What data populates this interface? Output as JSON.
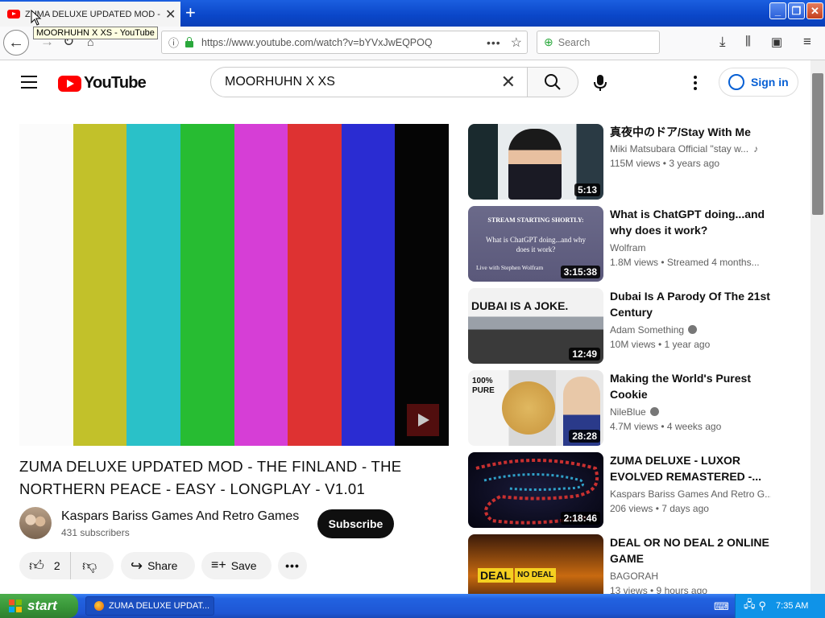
{
  "browser": {
    "tab_title": "ZUMA DELUXE UPDATED MOD - THE FINLAND",
    "tooltip": "MOORHUHN X XS - YouTube",
    "url": "https://www.youtube.com/watch?v=bYVxJwEQPOQ",
    "search_placeholder": "Search"
  },
  "yt_header": {
    "logo_text": "YouTube",
    "search_query": "MOORHUHN X XS",
    "signin_label": "Sign in"
  },
  "player": {
    "colors": [
      "#fbfbfb",
      "#c2c12a",
      "#2ac1c8",
      "#27bc32",
      "#d63ed6",
      "#de3232",
      "#2a2cd2",
      "#050505"
    ]
  },
  "video": {
    "title": "ZUMA DELUXE UPDATED MOD - THE FINLAND - THE NORTHERN PEACE - EASY - LONGPLAY - V1.01",
    "channel": "Kaspars Bariss Games And Retro Games",
    "subscribers": "431 subscribers",
    "subscribe_label": "Subscribe",
    "likes": "2",
    "share_label": "Share",
    "save_label": "Save"
  },
  "recommendations": [
    {
      "title": "真夜中のドア/Stay With Me",
      "channel": "Miki Matsubara Official \"stay w...",
      "meta": "115M views  •  3 years ago",
      "duration": "5:13",
      "verified": false
    },
    {
      "title": "What is ChatGPT doing...and why does it work?",
      "channel": "Wolfram",
      "meta": "1.8M views  •  Streamed 4 months...",
      "duration": "3:15:38",
      "verified": false,
      "thumb_text": "STREAM STARTING SHORTLY:",
      "thumb_text2": "What is ChatGPT doing...and why does it work?",
      "thumb_text3": "Live with Stephen Wolfram"
    },
    {
      "title": "Dubai Is A Parody Of The 21st Century",
      "channel": "Adam Something",
      "meta": "10M views  •  1 year ago",
      "duration": "12:49",
      "verified": true,
      "thumb_text": "DUBAI IS A JOKE."
    },
    {
      "title": "Making the World's Purest Cookie",
      "channel": "NileBlue",
      "meta": "4.7M views  •  4 weeks ago",
      "duration": "28:28",
      "verified": true,
      "thumb_text": "100% PURE"
    },
    {
      "title": "ZUMA DELUXE - LUXOR EVOLVED REMASTERED -...",
      "channel": "Kaspars Bariss Games And Retro G...",
      "meta": "206 views  •  7 days ago",
      "duration": "2:18:46",
      "verified": false
    },
    {
      "title": "DEAL OR NO DEAL 2 ONLINE GAME",
      "channel": "BAGORAH",
      "meta": "13 views  •  9 hours ago",
      "duration": "",
      "verified": false,
      "thumb_text": "DEAL",
      "thumb_text2": "NO DEAL"
    }
  ],
  "taskbar": {
    "start_label": "start",
    "task_label": "ZUMA DELUXE UPDAT...",
    "clock": "7:35 AM"
  }
}
